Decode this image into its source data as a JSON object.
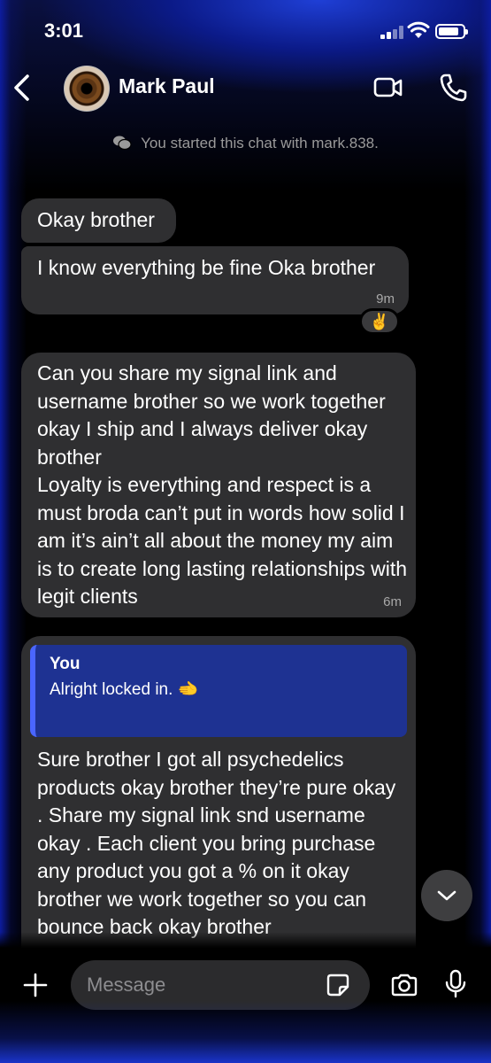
{
  "status_bar": {
    "time": "3:01"
  },
  "header": {
    "contact_name": "Mark Paul"
  },
  "system_note": "You started this chat with mark.838.",
  "messages": [
    {
      "text": "Okay brother"
    },
    {
      "text": "I know everything be fine Oka brother",
      "time": "9m",
      "reaction": "✌️"
    },
    {
      "text": "Can you share my signal link and username brother so we work together okay I ship and I always deliver okay brother\nLoyalty is everything and respect is a must broda can’t put in words how solid I am it’s ain’t all about the money my aim is to create long lasting relationships with legit clients",
      "time": "6m"
    },
    {
      "quote": {
        "author": "You",
        "text": "Alright locked in. 🫲"
      },
      "text": "Sure brother I got all psychedelics products okay brother they’re pure okay . Share my signal link snd username okay . Each client you bring purchase any product you got a % on it okay brother we work together so you can bounce back okay brother"
    }
  ],
  "composer": {
    "placeholder": "Message"
  }
}
